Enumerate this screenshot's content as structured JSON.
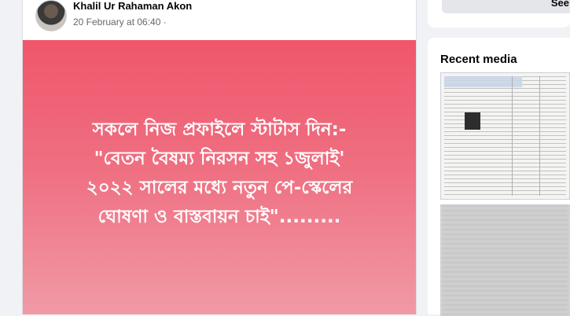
{
  "post": {
    "author": "Khalil Ur Rahaman Akon",
    "timestamp": "20 February at 06:40 ·",
    "status_text": "সকলে নিজ প্রফাইলে স্টাটাস দিন:-\n\"বেতন বৈষম্য নিরসন সহ ১জুলাই'\n২০২২ সালের মধ্যে নতুন পে-স্কেলের\nঘোষণা ও বাস্তবায়ন চাই\".........",
    "card_colors": {
      "top": "#f0566c",
      "bottom": "#f09aa6"
    }
  },
  "sidebar": {
    "top_button_label": "See",
    "recent_media_title": "Recent media"
  }
}
